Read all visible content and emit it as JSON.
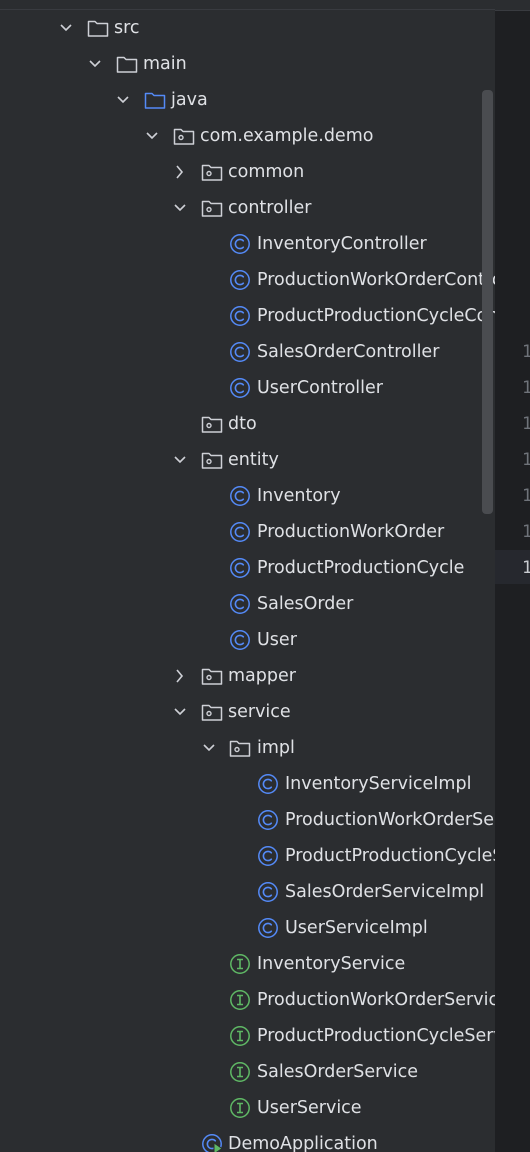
{
  "tree": {
    "items": [
      {
        "label": "src",
        "type": "folder",
        "state": "expanded"
      },
      {
        "label": "main",
        "type": "folder",
        "state": "expanded"
      },
      {
        "label": "java",
        "type": "source-folder",
        "state": "expanded"
      },
      {
        "label": "com.example.demo",
        "type": "package",
        "state": "expanded"
      },
      {
        "label": "common",
        "type": "package",
        "state": "collapsed"
      },
      {
        "label": "controller",
        "type": "package",
        "state": "expanded"
      },
      {
        "label": "InventoryController",
        "type": "class"
      },
      {
        "label": "ProductionWorkOrderController",
        "type": "class"
      },
      {
        "label": "ProductProductionCycleController",
        "type": "class"
      },
      {
        "label": "SalesOrderController",
        "type": "class"
      },
      {
        "label": "UserController",
        "type": "class"
      },
      {
        "label": "dto",
        "type": "package",
        "state": "empty"
      },
      {
        "label": "entity",
        "type": "package",
        "state": "expanded"
      },
      {
        "label": "Inventory",
        "type": "class"
      },
      {
        "label": "ProductionWorkOrder",
        "type": "class"
      },
      {
        "label": "ProductProductionCycle",
        "type": "class"
      },
      {
        "label": "SalesOrder",
        "type": "class"
      },
      {
        "label": "User",
        "type": "class"
      },
      {
        "label": "mapper",
        "type": "package",
        "state": "collapsed"
      },
      {
        "label": "service",
        "type": "package",
        "state": "expanded"
      },
      {
        "label": "impl",
        "type": "package",
        "state": "expanded"
      },
      {
        "label": "InventoryServiceImpl",
        "type": "class"
      },
      {
        "label": "ProductionWorkOrderServiceImpl",
        "type": "class"
      },
      {
        "label": "ProductProductionCycleServiceImpl",
        "type": "class"
      },
      {
        "label": "SalesOrderServiceImpl",
        "type": "class"
      },
      {
        "label": "UserServiceImpl",
        "type": "class"
      },
      {
        "label": "InventoryService",
        "type": "interface"
      },
      {
        "label": "ProductionWorkOrderService",
        "type": "interface"
      },
      {
        "label": "ProductProductionCycleService",
        "type": "interface"
      },
      {
        "label": "SalesOrderService",
        "type": "interface"
      },
      {
        "label": "UserService",
        "type": "interface"
      },
      {
        "label": "DemoApplication",
        "type": "main-class"
      }
    ]
  },
  "editor": {
    "line_numbers": [
      "1",
      "1",
      "1",
      "1",
      "1",
      "1",
      "1"
    ]
  },
  "colors": {
    "panel_background": "#2b2d30",
    "editor_background": "#1e1f22",
    "text": "#dfe1e5",
    "class_icon": "#548af7",
    "interface_icon": "#5fb865",
    "source_folder_icon": "#548af7"
  }
}
